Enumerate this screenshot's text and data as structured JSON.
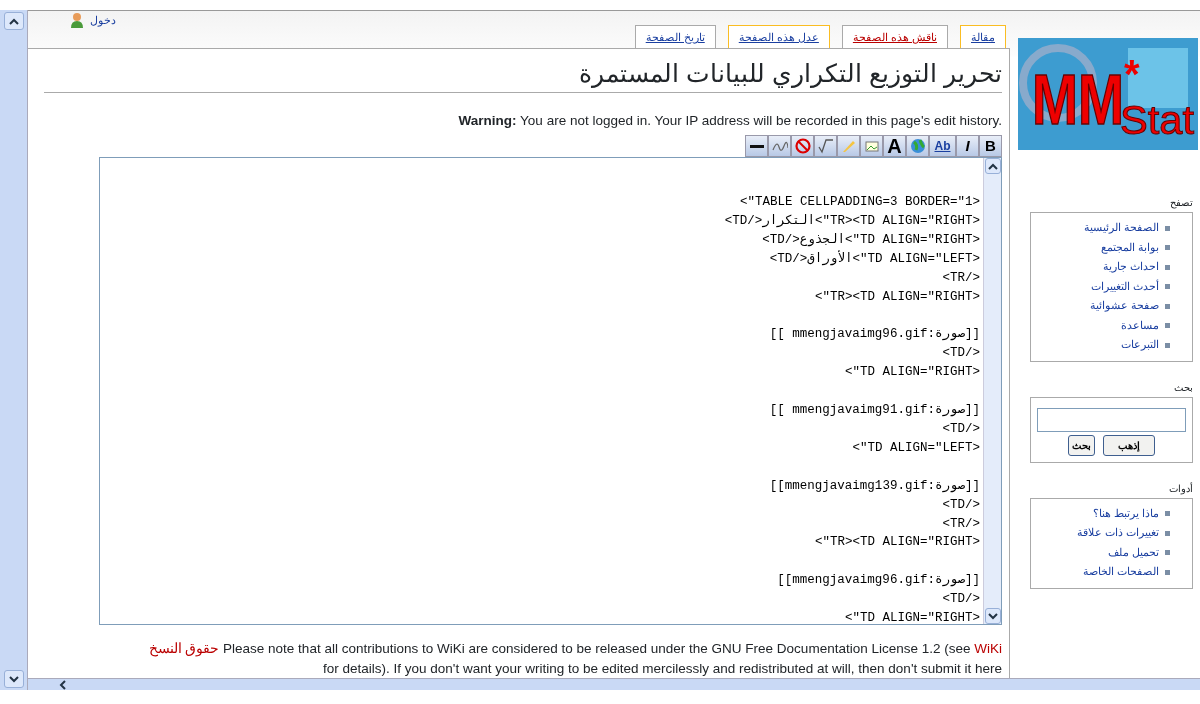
{
  "user_link": {
    "label": "دخول"
  },
  "tabs": [
    {
      "label": "مقالة",
      "selected": true,
      "kind": "normal"
    },
    {
      "label": "ناقش هذه الصفحة",
      "selected": false,
      "kind": "new"
    },
    {
      "label": "عدل هذه الصفحة",
      "selected": true,
      "kind": "normal"
    },
    {
      "label": "تاريخ الصفحة",
      "selected": false,
      "kind": "normal"
    }
  ],
  "logo": {
    "title": "MM",
    "mark": "*",
    "subtitle": "Stat"
  },
  "page_title": "تحرير التوزيع التكراري للبيانات المستمرة",
  "warning": "**Warning:** You are not logged in. Your IP address will be recorded in this page's edit history.",
  "toolbar": [
    {
      "kind": "bold",
      "label": "B"
    },
    {
      "kind": "italic",
      "label": "I"
    },
    {
      "kind": "link",
      "label": "Ab"
    },
    {
      "kind": "globe"
    },
    {
      "kind": "headline",
      "label": "A"
    },
    {
      "kind": "image"
    },
    {
      "kind": "media"
    },
    {
      "kind": "math"
    },
    {
      "kind": "nowiki"
    },
    {
      "kind": "signature"
    },
    {
      "kind": "rule"
    }
  ],
  "editor": {
    "value": "<TABLE CELLPADDING=3 BORDER=\"1\">\n<TR><TD ALIGN=\"RIGHT\">التكرار</TD>\n<TD ALIGN=\"RIGHT\">الجذوع</TD>\n<TD ALIGN=\"LEFT\">الأوراق</TD>\n</TR>\n<TR><TD ALIGN=\"RIGHT\">\n\n[[صورة:mmengjavaimg96.gif ]]\n</TD>\n<TD ALIGN=\"RIGHT\">\n\n[[صورة:mmengjavaimg91.gif ]]\n</TD>\n<TD ALIGN=\"LEFT\">\n\n[[صورة:mmengjavaimg139.gif]]\n</TD>\n</TR>\n<TR><TD ALIGN=\"RIGHT\">\n\n[[صورة:mmengjavaimg96.gif]]\n</TD>\n<TD ALIGN=\"RIGHT\">"
  },
  "notice": {
    "copyright_link": "حقوق النسخ",
    "text": "Please note that all contributions to WiKi are considered to be released under the GNU Free Documentation License 1.2 (see",
    "wiki_link": "WiKi",
    "second_line": "for details). If you don't want your writing to be edited mercilessly and redistributed at will, then don't submit it here"
  },
  "sidebar": {
    "navigation": {
      "heading": "تصفح",
      "items": [
        "الصفحة الرئيسية",
        "بوابة المجتمع",
        "احداث جارية",
        "أحدث التغييرات",
        "صفحة عشوائية",
        "مساعدة",
        "التبرعات"
      ]
    },
    "search": {
      "heading": "بحث",
      "go_button": "إذهب",
      "search_button": "بحث"
    },
    "tools": {
      "heading": "أدوات",
      "items": [
        "ماذا يرتبط هنا؟",
        "تغييرات ذات علاقة",
        "تحميل ملف",
        "الصفحات الخاصة"
      ]
    }
  }
}
